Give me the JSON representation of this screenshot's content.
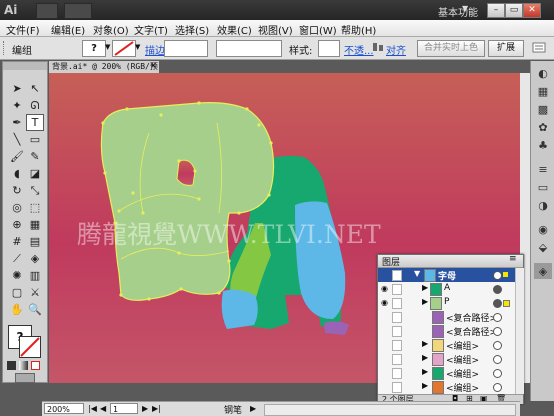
{
  "app": {
    "logo": "Ai",
    "workspace": "基本功能"
  },
  "window_controls": {
    "minimize": "–",
    "restore": "▭",
    "close": "✕"
  },
  "menu": [
    "文件(F)",
    "编辑(E)",
    "对象(O)",
    "文字(T)",
    "选择(S)",
    "效果(C)",
    "视图(V)",
    "窗口(W)",
    "帮助(H)"
  ],
  "control_bar": {
    "selection": "编组",
    "stroke_label": "描边:",
    "style_label": "样式:",
    "opacity_link": "不透...",
    "align_link": "对齐",
    "live_color_btn": "合并实时上色",
    "expand_btn": "扩展"
  },
  "document": {
    "tab": "背景.ai* @ 200% (RGB/预览)",
    "close": "✕"
  },
  "watermark": "腾龍視覺WWW.TLVI.NET",
  "colors": {
    "bg_top": "#c65f57",
    "bg_bottom": "#c03a5e",
    "elephant": "#a6cf8c",
    "elephant_stroke": "#e8ee5a",
    "teal": "#17a86f",
    "green": "#83c742",
    "blue": "#5db8e8",
    "purple": "#9a63b6"
  },
  "layers_panel": {
    "title": "图层",
    "rows": [
      {
        "label": "字母",
        "type": "layer",
        "selected": true
      },
      {
        "label": "A",
        "type": "sub"
      },
      {
        "label": "P",
        "type": "sub"
      },
      {
        "label": "<复合路径>",
        "type": "item"
      },
      {
        "label": "<复合路径>",
        "type": "item"
      },
      {
        "label": "<编组>",
        "type": "item"
      },
      {
        "label": "<编组>",
        "type": "item"
      },
      {
        "label": "<编组>",
        "type": "item"
      },
      {
        "label": "<编组>",
        "type": "item"
      }
    ],
    "footer": "2 个图层"
  },
  "status": {
    "zoom": "200%",
    "page": "1",
    "tool": "钢笔"
  }
}
